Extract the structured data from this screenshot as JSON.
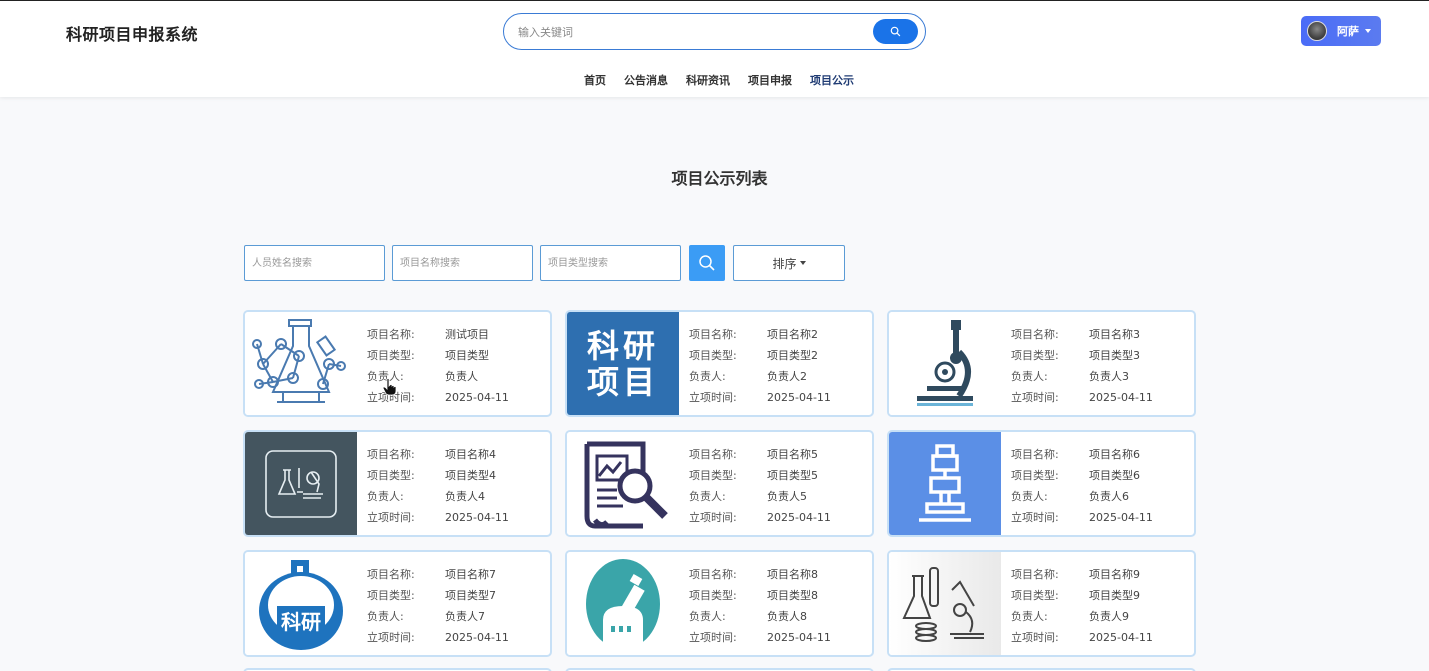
{
  "app": {
    "title": "科研项目申报系统"
  },
  "search": {
    "placeholder": "输入关键词"
  },
  "user": {
    "name": "阿萨"
  },
  "nav": {
    "items": [
      {
        "label": "首页",
        "active": false
      },
      {
        "label": "公告消息",
        "active": false
      },
      {
        "label": "科研资讯",
        "active": false
      },
      {
        "label": "项目申报",
        "active": false
      },
      {
        "label": "项目公示",
        "active": true
      }
    ]
  },
  "page": {
    "title": "项目公示列表"
  },
  "filters": {
    "name_placeholder": "人员姓名搜索",
    "project_placeholder": "项目名称搜索",
    "type_placeholder": "项目类型搜索",
    "sort_label": "排序"
  },
  "labels": {
    "name": "项目名称:",
    "type": "项目类型:",
    "owner": "负责人:",
    "date": "立项时间:"
  },
  "cards": [
    {
      "name": "测试项目",
      "type": "项目类型",
      "owner": "负责人",
      "date": "2025-04-11",
      "image": "molecule-flask-icon"
    },
    {
      "name": "项目名称2",
      "type": "项目类型2",
      "owner": "负责人2",
      "date": "2025-04-11",
      "image": "keyan-xiangmu-text-icon",
      "image_text": "科研项目"
    },
    {
      "name": "项目名称3",
      "type": "项目类型3",
      "owner": "负责人3",
      "date": "2025-04-11",
      "image": "microscope-icon"
    },
    {
      "name": "项目名称4",
      "type": "项目类型4",
      "owner": "负责人4",
      "date": "2025-04-11",
      "image": "lab-tools-icon"
    },
    {
      "name": "项目名称5",
      "type": "项目类型5",
      "owner": "负责人5",
      "date": "2025-04-11",
      "image": "document-magnifier-icon"
    },
    {
      "name": "项目名称6",
      "type": "项目类型6",
      "owner": "负责人6",
      "date": "2025-04-11",
      "image": "microscope-blue-icon"
    },
    {
      "name": "项目名称7",
      "type": "项目类型7",
      "owner": "负责人7",
      "date": "2025-04-11",
      "image": "keyan-flask-icon",
      "image_text": "科研"
    },
    {
      "name": "项目名称8",
      "type": "项目类型8",
      "owner": "负责人8",
      "date": "2025-04-11",
      "image": "telescope-icon"
    },
    {
      "name": "项目名称9",
      "type": "项目类型9",
      "owner": "负责人9",
      "date": "2025-04-11",
      "image": "beakers-microscope-icon"
    }
  ],
  "colors": {
    "accent": "#1a73e8",
    "card_border": "#c7e0f6",
    "nav_active": "#1f3b73"
  }
}
